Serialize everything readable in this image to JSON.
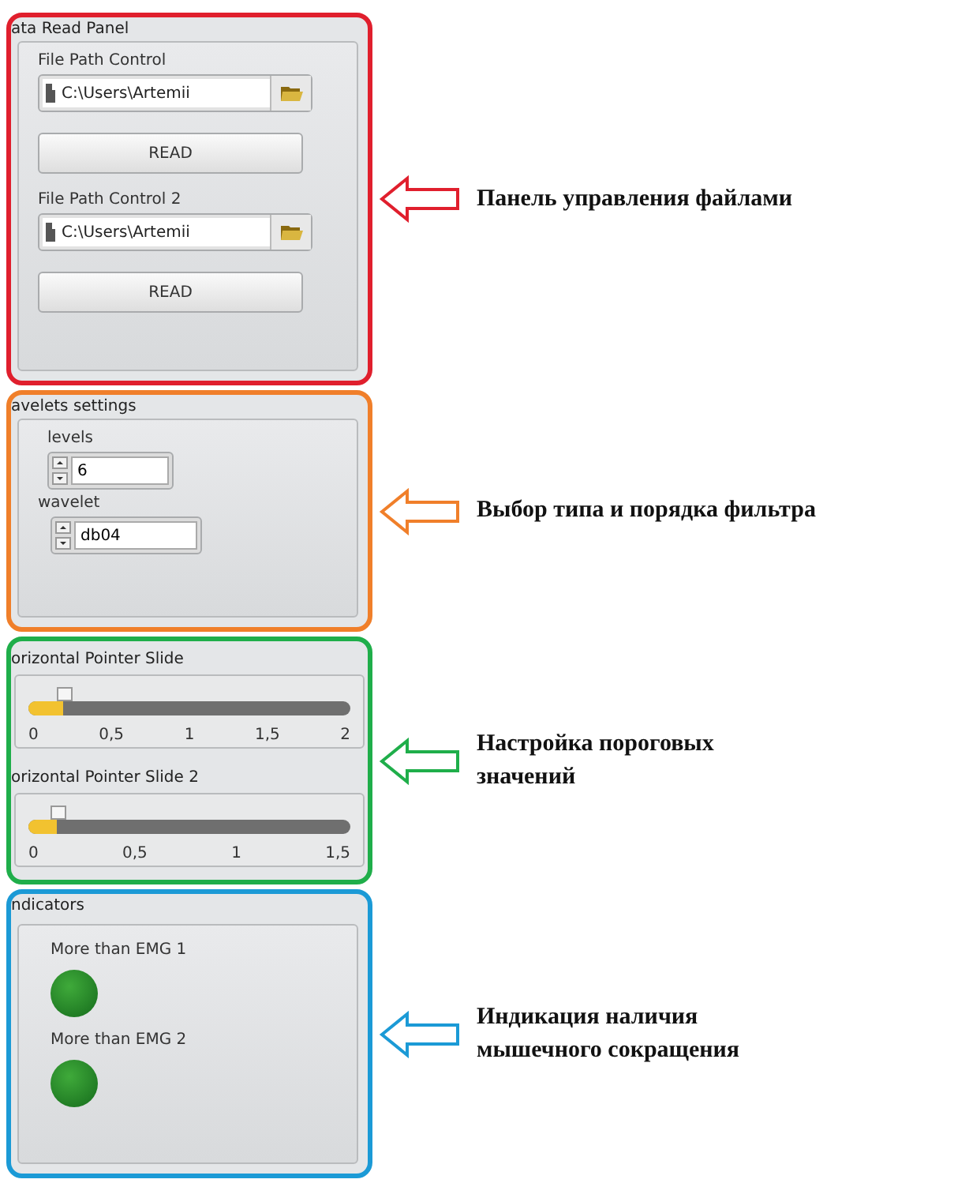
{
  "sections": [
    {
      "kind": "file_read",
      "title": "ata Read Panel",
      "color": "#e01f2d",
      "callout": "Панель управления файлами",
      "controls": [
        {
          "label": "File Path Control",
          "path": "C:\\Users\\Artemii",
          "button": "READ"
        },
        {
          "label": "File Path Control 2",
          "path": "C:\\Users\\Artemii",
          "button": "READ"
        }
      ]
    },
    {
      "kind": "wavelets",
      "title": "avelets settings",
      "color": "#f07f2a",
      "callout": "Выбор типа и порядка фильтра",
      "fields": [
        {
          "label": "levels",
          "value": "6"
        },
        {
          "label": "wavelet",
          "value": "db04"
        }
      ]
    },
    {
      "kind": "sliders",
      "color": "#1fae4a",
      "callout": "Настройка пороговых\nзначений",
      "sliders": [
        {
          "label": "orizontal Pointer Slide",
          "level": 0.11,
          "ticks": [
            "0",
            "0,5",
            "1",
            "1,5",
            "2"
          ]
        },
        {
          "label": "orizontal Pointer Slide 2",
          "level": 0.09,
          "ticks": [
            "0",
            "0,5",
            "1",
            "1,5"
          ]
        }
      ]
    },
    {
      "kind": "indicators",
      "title": "ndicators",
      "color": "#1b9ad6",
      "callout": "Индикация наличия\nмышечного сокращения",
      "leds": [
        {
          "label": "More than EMG 1",
          "on": true
        },
        {
          "label": "More than EMG 2",
          "on": true
        }
      ]
    }
  ]
}
